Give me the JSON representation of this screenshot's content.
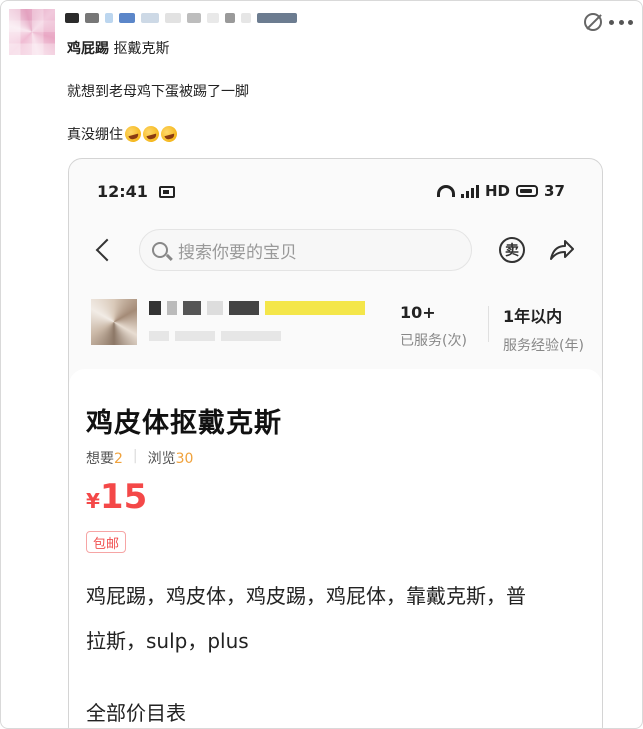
{
  "post": {
    "author": "鸡屁踢",
    "author_suffix": "抠戴克斯",
    "line2": "就想到老母鸡下蛋被踢了一脚",
    "line3": "真没绷住"
  },
  "phone": {
    "status": {
      "time": "12:41",
      "network": "HD",
      "battery": "37"
    },
    "search": {
      "placeholder": "搜索你要的宝贝"
    },
    "sell_icon_label": "卖",
    "stats": [
      {
        "value": "10+",
        "label": "已服务(次)"
      },
      {
        "value": "1年以内",
        "label": "服务经验(年)"
      }
    ],
    "product": {
      "title": "鸡皮体抠戴克斯",
      "want_label": "想要",
      "want_count": "2",
      "view_label": "浏览",
      "view_count": "30",
      "currency": "¥",
      "price": "15",
      "badge": "包邮",
      "desc_line1": "鸡屁踢，鸡皮体，鸡皮踢，鸡屁体，靠戴克斯，普",
      "desc_line2": "拉斯，sulp，plus",
      "section_title": "全部价目表"
    }
  },
  "colors": {
    "price": "#f44848",
    "meta_count": "#f0a23c",
    "badge": "#f14f4f"
  }
}
